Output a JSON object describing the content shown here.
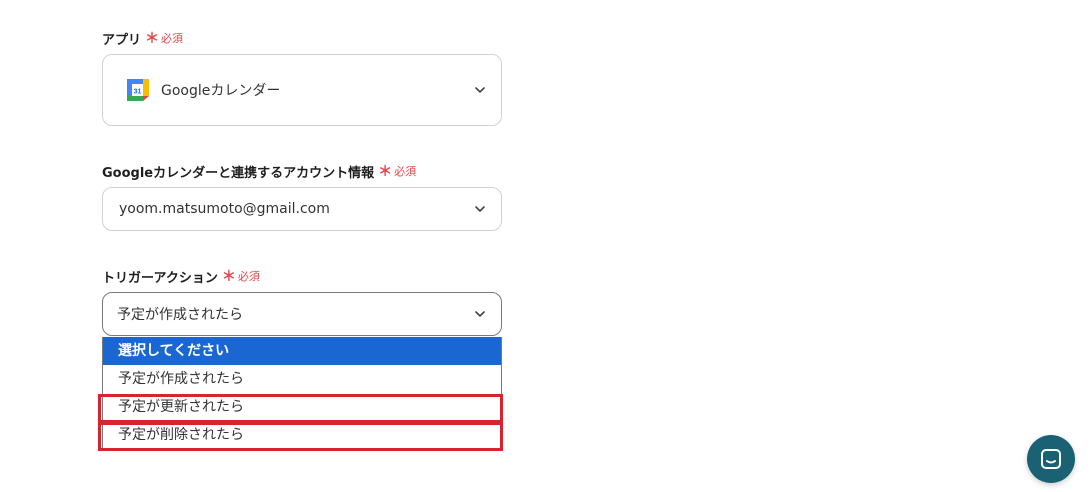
{
  "app_field": {
    "label": "アプリ",
    "required_mark": "＊",
    "required_text": "必須",
    "selected_app": "Googleカレンダー",
    "app_icon": "google-calendar-icon",
    "icon_number": "31"
  },
  "account_field": {
    "label": "Googleカレンダーと連携するアカウント情報",
    "required_mark": "＊",
    "required_text": "必須",
    "value": "yoom.matsumoto@gmail.com"
  },
  "trigger_field": {
    "label": "トリガーアクション",
    "required_mark": "＊",
    "required_text": "必須",
    "value": "予定が作成されたら",
    "options": [
      "選択してください",
      "予定が作成されたら",
      "予定が更新されたら",
      "予定が削除されたら"
    ]
  },
  "colors": {
    "required": "#e5484d",
    "option_selected_bg": "#1a66d2",
    "highlight_border": "#d9232d",
    "chat_button": "#1a6273"
  },
  "chat": {
    "icon": "chat-icon"
  }
}
